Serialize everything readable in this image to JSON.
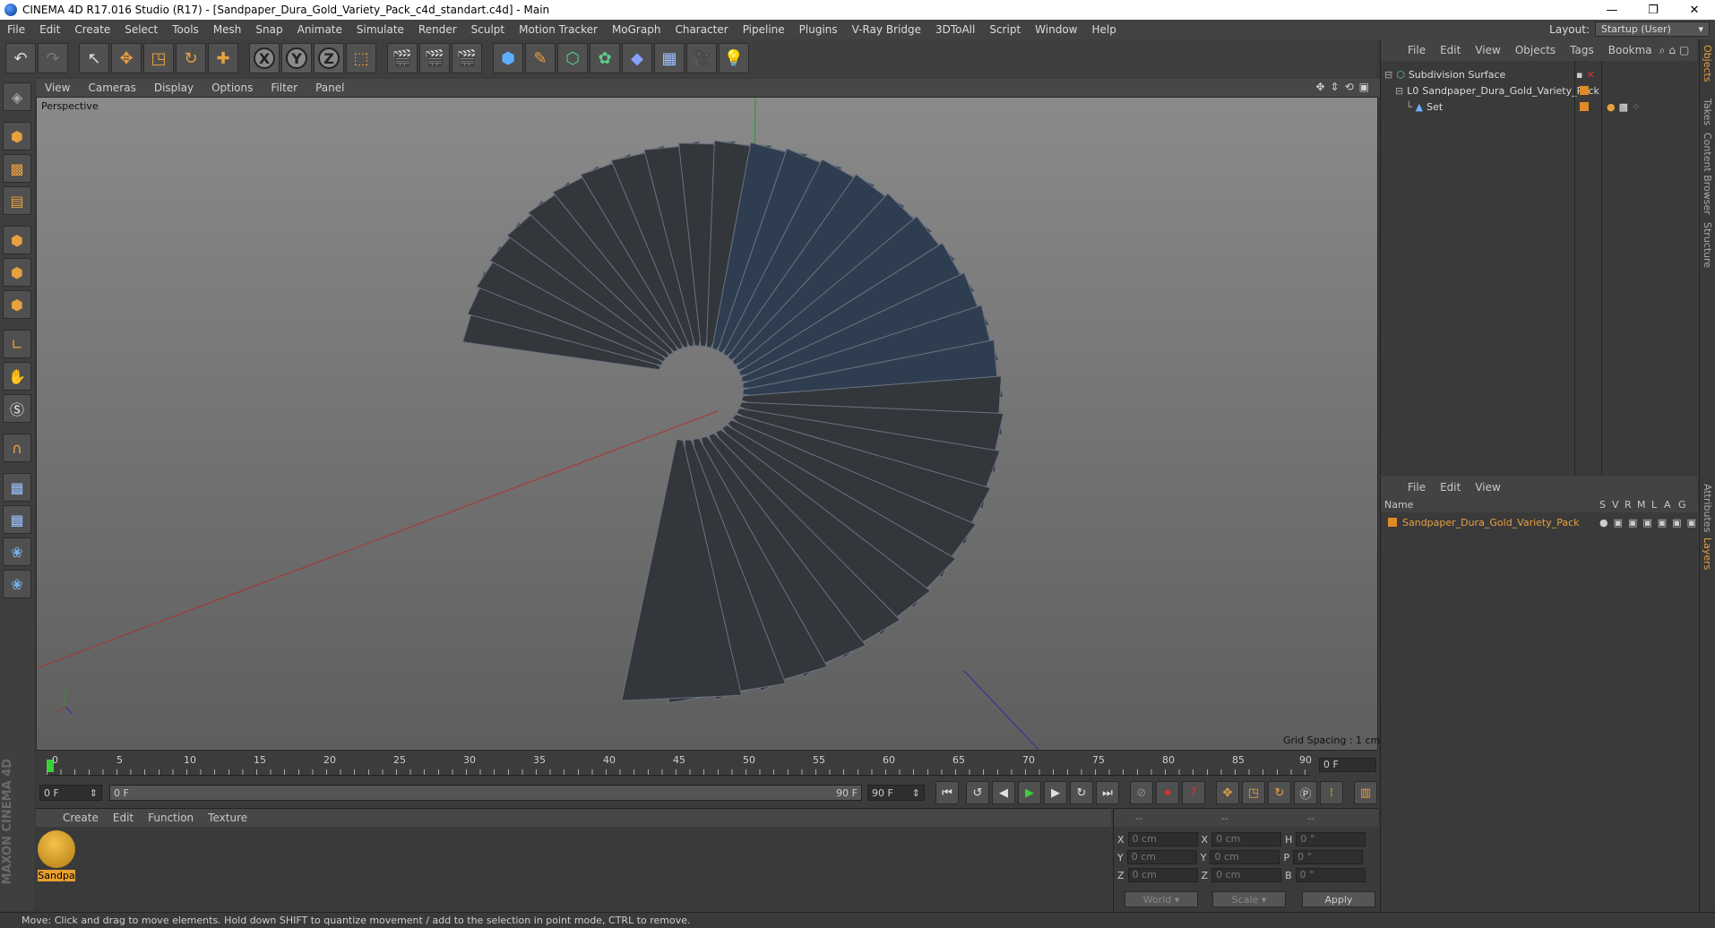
{
  "window": {
    "title": "CINEMA 4D R17.016 Studio (R17) - [Sandpaper_Dura_Gold_Variety_Pack_c4d_standart.c4d] - Main",
    "controls": [
      "—",
      "❐",
      "✕"
    ]
  },
  "menu": [
    "File",
    "Edit",
    "Create",
    "Select",
    "Tools",
    "Mesh",
    "Snap",
    "Animate",
    "Simulate",
    "Render",
    "Sculpt",
    "Motion Tracker",
    "MoGraph",
    "Character",
    "Pipeline",
    "Plugins",
    "V-Ray Bridge",
    "3DToAll",
    "Script",
    "Window",
    "Help"
  ],
  "layout": {
    "label": "Layout:",
    "value": "Startup (User)"
  },
  "viewport": {
    "menu": [
      "View",
      "Cameras",
      "Display",
      "Options",
      "Filter",
      "Panel"
    ],
    "camera": "Perspective",
    "grid_spacing": "Grid Spacing : 1 cm"
  },
  "timeline": {
    "ticks": [
      "0",
      "5",
      "10",
      "15",
      "20",
      "25",
      "30",
      "35",
      "40",
      "45",
      "50",
      "55",
      "60",
      "65",
      "70",
      "75",
      "80",
      "85",
      "90"
    ],
    "current_frame": "0 F",
    "start": "0 F",
    "range_start": "0 F",
    "range_end": "90 F",
    "end": "90 F"
  },
  "materials": {
    "menu": [
      "Create",
      "Edit",
      "Function",
      "Texture"
    ],
    "item": "Sandpa"
  },
  "coords": {
    "headers": [
      "--",
      "--",
      "--"
    ],
    "rows": [
      {
        "a": "X",
        "av": "0 cm",
        "b": "X",
        "bv": "0 cm",
        "c": "H",
        "cv": "0 °"
      },
      {
        "a": "Y",
        "av": "0 cm",
        "b": "Y",
        "bv": "0 cm",
        "c": "P",
        "cv": "0 °"
      },
      {
        "a": "Z",
        "av": "0 cm",
        "b": "Z",
        "bv": "0 cm",
        "c": "B",
        "cv": "0 °"
      }
    ],
    "mode": "World",
    "scale": "Scale",
    "apply": "Apply"
  },
  "objects": {
    "menu": [
      "File",
      "Edit",
      "View",
      "Objects",
      "Tags",
      "Bookma"
    ],
    "tree": [
      "Subdivision Surface",
      "Sandpaper_Dura_Gold_Variety_Pack",
      "Set"
    ]
  },
  "layers": {
    "menu": [
      "File",
      "Edit",
      "View"
    ],
    "columns": [
      "Name",
      "S",
      "V",
      "R",
      "M",
      "L",
      "A",
      "G"
    ],
    "item": "Sandpaper_Dura_Gold_Variety_Pack"
  },
  "side_tabs": [
    "Objects",
    "Takes",
    "Content Browser",
    "Structure",
    "Attributes",
    "Layers"
  ],
  "brand": {
    "maxon": "MAXON",
    "c4d": "CINEMA 4D"
  },
  "status": "Move: Click and drag to move elements. Hold down SHIFT to quantize movement / add to the selection in point mode, CTRL to remove.",
  "colors": {
    "accent": "#e8a040",
    "viewport_top": "#8a8a8a",
    "viewport_bottom": "#5e5e5e",
    "panel": "#3a3a3a"
  }
}
